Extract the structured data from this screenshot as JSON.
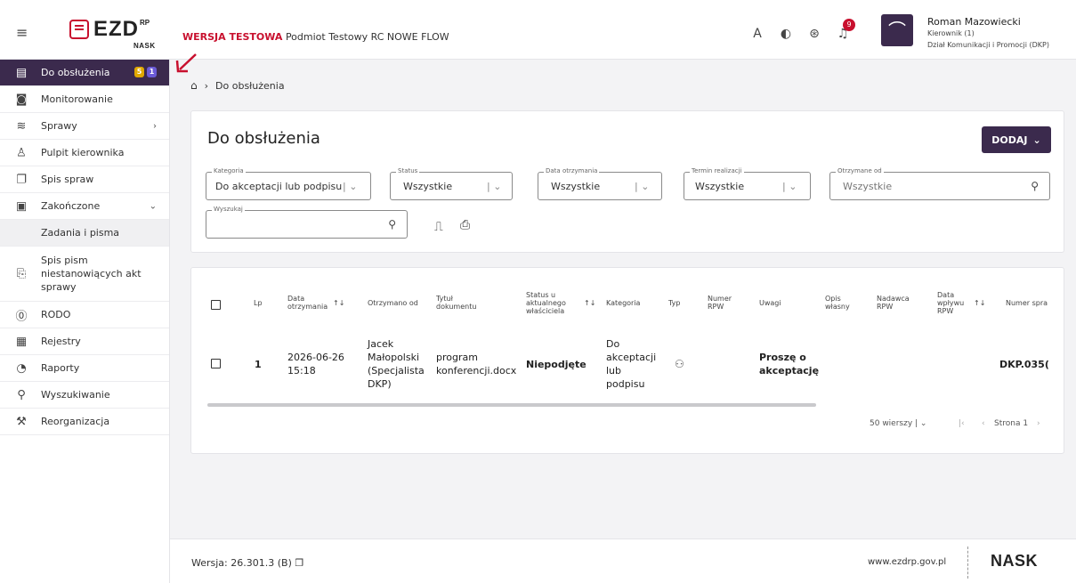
{
  "header": {
    "logo_text": "EZD",
    "logo_sup": "RP",
    "logo_nask": "NASK",
    "env_label": "WERSJA TESTOWA",
    "env_subject": "Podmiot Testowy RC NOWE FLOW",
    "font_icon": "A",
    "notifications_count": "9",
    "user_name": "Roman Mazowiecki",
    "user_role": "Kierownik (1)",
    "user_dept": "Dział Komunikacji i Promocji (DKP)"
  },
  "sidebar": {
    "items": [
      {
        "label": "Do obsłużenia",
        "icon": "clipboard-list-icon",
        "badge1": "5",
        "badge2": "1"
      },
      {
        "label": "Monitorowanie",
        "icon": "monitor-eye-icon"
      },
      {
        "label": "Sprawy",
        "icon": "layers-icon"
      },
      {
        "label": "Pulpit kierownika",
        "icon": "manager-icon"
      },
      {
        "label": "Spis spraw",
        "icon": "folders-icon"
      },
      {
        "label": "Zakończone",
        "icon": "clipboard-check-icon"
      },
      {
        "label": "Zadania i pisma"
      },
      {
        "label": "Spis pism niestanowiących akt sprawy",
        "icon": "documents-icon"
      },
      {
        "label": "RODO",
        "icon": "rodo-shield-icon"
      },
      {
        "label": "Rejestry",
        "icon": "register-icon"
      },
      {
        "label": "Raporty",
        "icon": "report-icon"
      },
      {
        "label": "Wyszukiwanie",
        "icon": "search-icon"
      },
      {
        "label": "Reorganizacja",
        "icon": "reorganization-icon"
      }
    ]
  },
  "breadcrumb": {
    "current": "Do obsłużenia"
  },
  "main": {
    "title": "Do obsłużenia",
    "add_button": "DODAJ",
    "filters": {
      "kategoria_label": "Kategoria",
      "kategoria_value": "Do akceptacji lub podpisu",
      "status_label": "Status",
      "status_value": "Wszystkie",
      "data_label": "Data otrzymania",
      "data_value": "Wszystkie",
      "termin_label": "Termin realizacji",
      "termin_value": "Wszystkie",
      "otrzymane_label": "Otrzymane od",
      "otrzymane_value": "Wszystkie",
      "wyszukaj_label": "Wyszukaj",
      "wyszukaj_value": ""
    }
  },
  "table": {
    "headers": {
      "lp": "Lp",
      "data": "Data otrzymania",
      "otrzymano": "Otrzymano od",
      "tytul": "Tytuł dokumentu",
      "status": "Status u aktualnego właściciela",
      "kategoria": "Kategoria",
      "typ": "Typ",
      "rpw": "Numer RPW",
      "uwagi": "Uwagi",
      "opis": "Opis własny",
      "nadawca": "Nadawca RPW",
      "wplyw": "Data wpływu RPW",
      "sprawa": "Numer spra"
    },
    "row": {
      "lp": "1",
      "data": "2026-06-26 15:18",
      "otrzymano": "Jacek Małopolski (Specjalista DKP)",
      "tytul": "program konferencji.docx",
      "status": "Niepodjęte",
      "kategoria": "Do akceptacji lub podpisu",
      "uwagi": "Proszę o akceptację",
      "sprawa": "DKP.035("
    },
    "pager": {
      "rows_per_page": "50 wierszy",
      "page": "Strona 1"
    }
  },
  "footer": {
    "version": "Wersja: 26.301.3 (B)",
    "site": "www.ezdrp.gov.pl",
    "brand": "NASK"
  },
  "colors": {
    "primary": "#3b2a4d",
    "accent": "#c8102e",
    "badge_yellow": "#e0a800",
    "badge_blue": "#6b5bd6"
  }
}
